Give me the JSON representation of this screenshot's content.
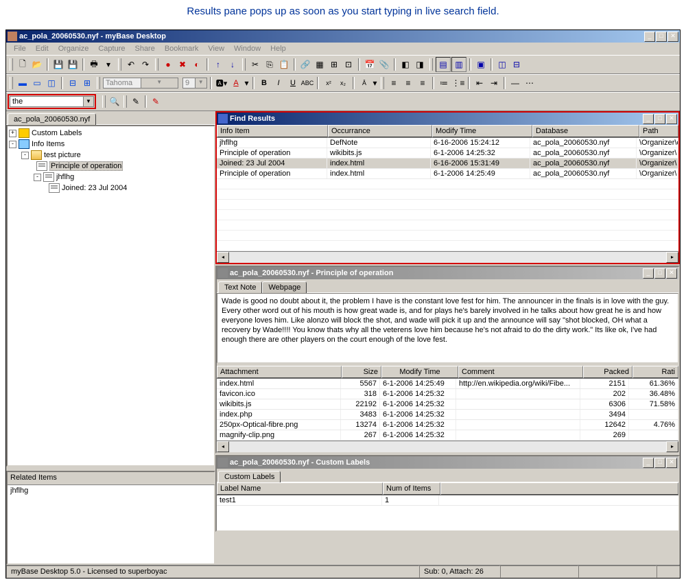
{
  "caption": "Results pane pops up as soon as you start typing in live search field.",
  "main_title": "ac_pola_20060530.nyf - myBase Desktop",
  "menus": [
    "File",
    "Edit",
    "Organize",
    "Capture",
    "Share",
    "Bookmark",
    "View",
    "Window",
    "Help"
  ],
  "search_value": "the",
  "font_name": "Tahoma",
  "font_size": "9",
  "tree_tab": "ac_pola_20060530.nyf",
  "tree": {
    "n0": "Custom Labels",
    "n1": "Info Items",
    "n2": "test picture",
    "n3": "Principle of operation",
    "n4": "jhflhg",
    "n5": "Joined: 23 Jul 2004"
  },
  "find": {
    "title": "Find Results",
    "cols": [
      "Info Item",
      "Occurrance",
      "Modify Time",
      "Database",
      "Path"
    ],
    "rows": [
      {
        "c0": "jhflhg",
        "c1": "DefNote",
        "c2": "6-16-2006 15:24:12",
        "c3": "ac_pola_20060530.nyf",
        "c4": "\\Organizer\\o"
      },
      {
        "c0": "Principle of operation",
        "c1": "wikibits.js",
        "c2": "6-1-2006 14:25:32",
        "c3": "ac_pola_20060530.nyf",
        "c4": "\\Organizer\\"
      },
      {
        "c0": "Joined: 23 Jul 2004",
        "c1": "index.html",
        "c2": "6-16-2006 15:31:49",
        "c3": "ac_pola_20060530.nyf",
        "c4": "\\Organizer\\"
      },
      {
        "c0": "Principle of operation",
        "c1": "index.html",
        "c2": "6-1-2006 14:25:49",
        "c3": "ac_pola_20060530.nyf",
        "c4": "\\Organizer\\"
      }
    ]
  },
  "note": {
    "title": "ac_pola_20060530.nyf - Principle of operation",
    "tabs": [
      "Text Note",
      "Webpage"
    ],
    "text": "Wade is good no doubt about it, the problem I have is the constant love fest for him. The announcer in the finals is in love with the guy. Every other word out of his mouth is how great wade is, and for plays he's barely involved in he talks about how great he is and how everyone loves him. Like alonzo will block the shot, and wade will pick it up and the announce will say \"shot blocked, OH what a recovery by Wade!!!! You know thats why all the veterens love him because he's not afraid to do the dirty work.\" Its like ok, I've had enough there are other players on the court enough of the love fest."
  },
  "attach": {
    "cols": [
      "Attachment",
      "Size",
      "Modify Time",
      "Comment",
      "Packed",
      "Rati"
    ],
    "rows": [
      {
        "c0": "index.html",
        "c1": "5567",
        "c2": "6-1-2006 14:25:49",
        "c3": "http://en.wikipedia.org/wiki/Fibe...",
        "c4": "2151",
        "c5": "61.36%"
      },
      {
        "c0": "favicon.ico",
        "c1": "318",
        "c2": "6-1-2006 14:25:32",
        "c3": "",
        "c4": "202",
        "c5": "36.48%"
      },
      {
        "c0": "wikibits.js",
        "c1": "22192",
        "c2": "6-1-2006 14:25:32",
        "c3": "",
        "c4": "6306",
        "c5": "71.58%"
      },
      {
        "c0": "index.php",
        "c1": "3483",
        "c2": "6-1-2006 14:25:32",
        "c3": "",
        "c4": "3494",
        "c5": ""
      },
      {
        "c0": "250px-Optical-fibre.png",
        "c1": "13274",
        "c2": "6-1-2006 14:25:32",
        "c3": "",
        "c4": "12642",
        "c5": "4.76%"
      },
      {
        "c0": "magnify-clip.png",
        "c1": "267",
        "c2": "6-1-2006 14:25:32",
        "c3": "",
        "c4": "269",
        "c5": ""
      }
    ]
  },
  "labels": {
    "title": "ac_pola_20060530.nyf - Custom Labels",
    "tab": "Custom Labels",
    "cols": [
      "Label Name",
      "Num of Items"
    ],
    "rows": [
      {
        "c0": "test1",
        "c1": "1"
      }
    ]
  },
  "related": {
    "header": "Related Items",
    "item": "jhflhg"
  },
  "status": {
    "left": "myBase Desktop 5.0 - Licensed to superboyac",
    "mid": "Sub: 0, Attach: 26"
  }
}
